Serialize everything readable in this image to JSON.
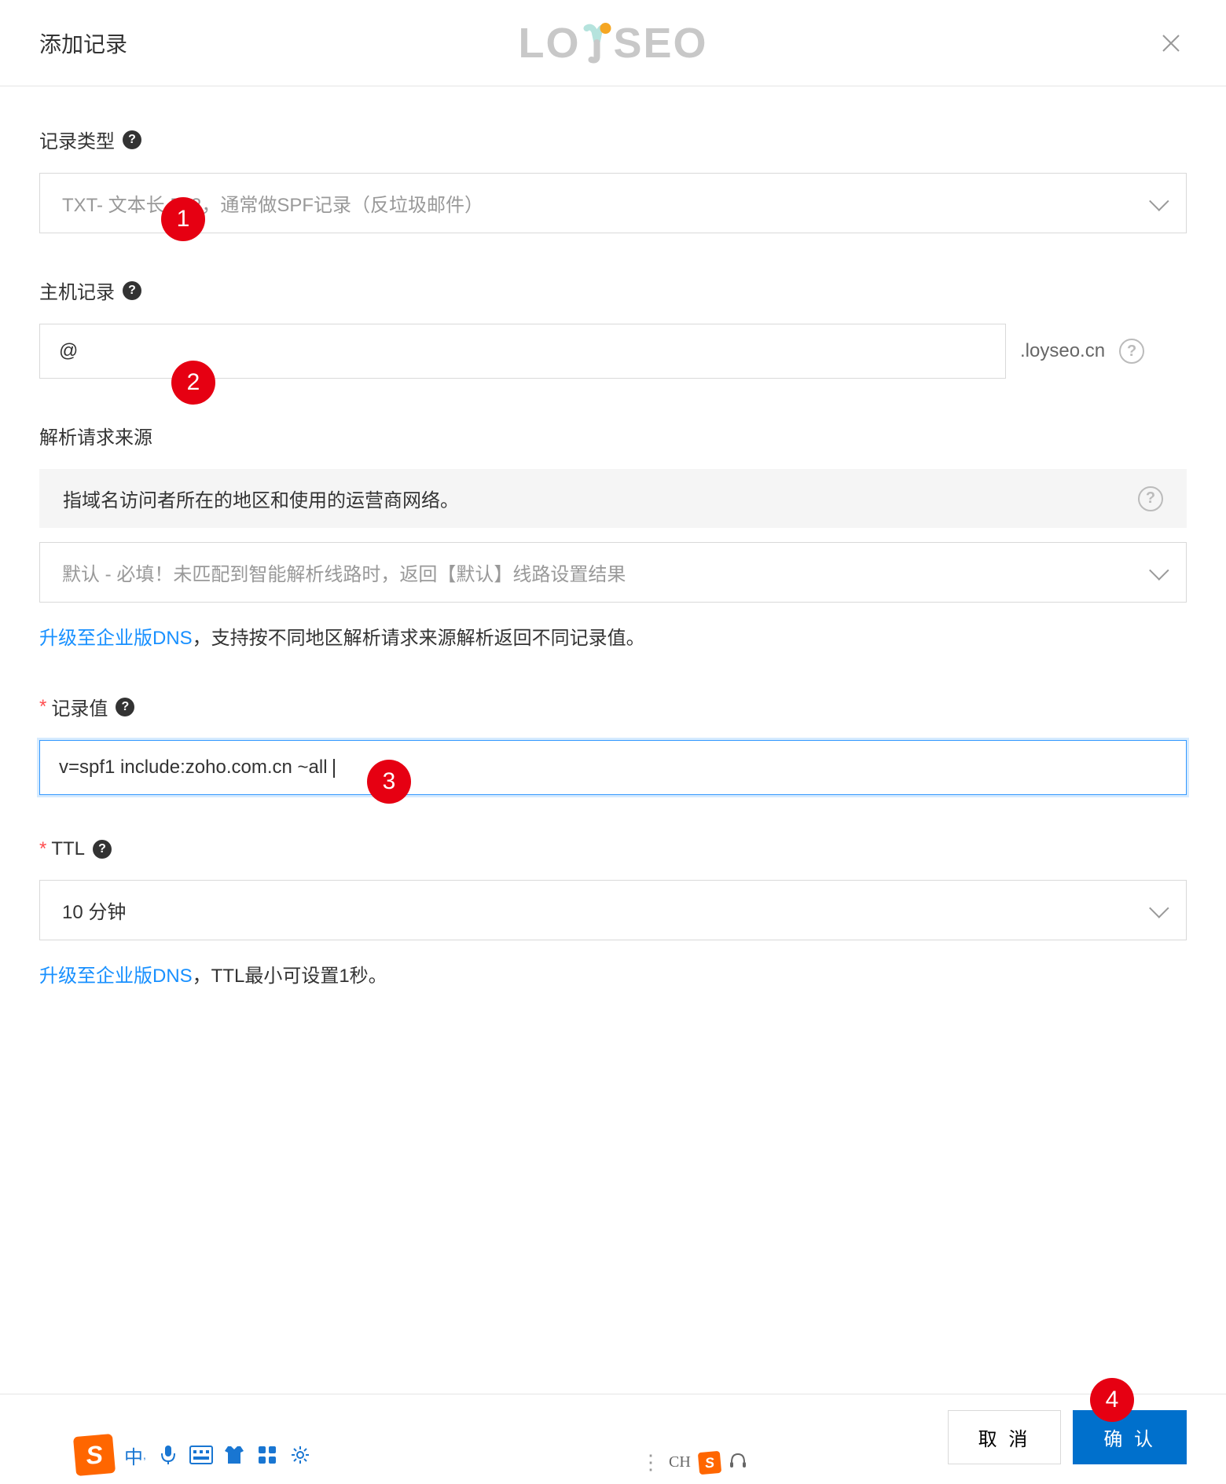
{
  "header": {
    "title": "添加记录",
    "logo_prefix": "LO",
    "logo_suffix": "SEO"
  },
  "form": {
    "record_type": {
      "label": "记录类型",
      "value": "TXT- 文本长            512，通常做SPF记录（反垃圾邮件）"
    },
    "host_record": {
      "label": "主机记录",
      "value": "@",
      "suffix": ".loyseo.cn"
    },
    "request_source": {
      "label": "解析请求来源",
      "info": "指域名访问者所在的地区和使用的运营商网络。",
      "value": "默认 - 必填！未匹配到智能解析线路时，返回【默认】线路设置结果",
      "hint_link": "升级至企业版DNS",
      "hint_text": "，支持按不同地区解析请求来源解析返回不同记录值。"
    },
    "record_value": {
      "label": "记录值",
      "value": "v=spf1 include:zoho.com.cn ~all"
    },
    "ttl": {
      "label": "TTL",
      "value": "10 分钟",
      "hint_link": "升级至企业版DNS",
      "hint_text": "，TTL最小可设置1秒。"
    }
  },
  "badges": {
    "b1": "1",
    "b2": "2",
    "b3": "3",
    "b4": "4"
  },
  "footer": {
    "cancel": "取 消",
    "confirm": "确 认"
  },
  "ime": {
    "ch": "CH"
  }
}
